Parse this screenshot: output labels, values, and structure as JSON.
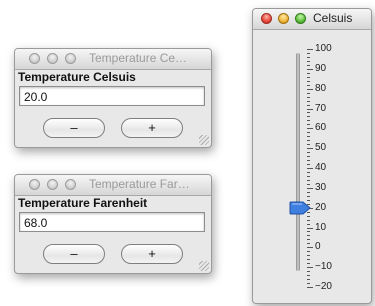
{
  "windows": {
    "celsius_field": {
      "title": "Temperature Ce…",
      "label": "Temperature Celsuis",
      "value": "20.0",
      "minus": "–",
      "plus": "+"
    },
    "fahrenheit_field": {
      "title": "Temperature Far…",
      "label": "Temperature Farenheit",
      "value": "68.0",
      "minus": "–",
      "plus": "+"
    },
    "slider": {
      "title": "Celsuis",
      "min": -20,
      "max": 100,
      "value": 20,
      "tick_labels": [
        "100",
        "90",
        "80",
        "70",
        "60",
        "50",
        "40",
        "30",
        "20",
        "10",
        "0",
        "−10",
        "−20"
      ]
    }
  },
  "colors": {
    "thumb": "#3f7fe0",
    "window_bg": "#e8e8e8"
  }
}
